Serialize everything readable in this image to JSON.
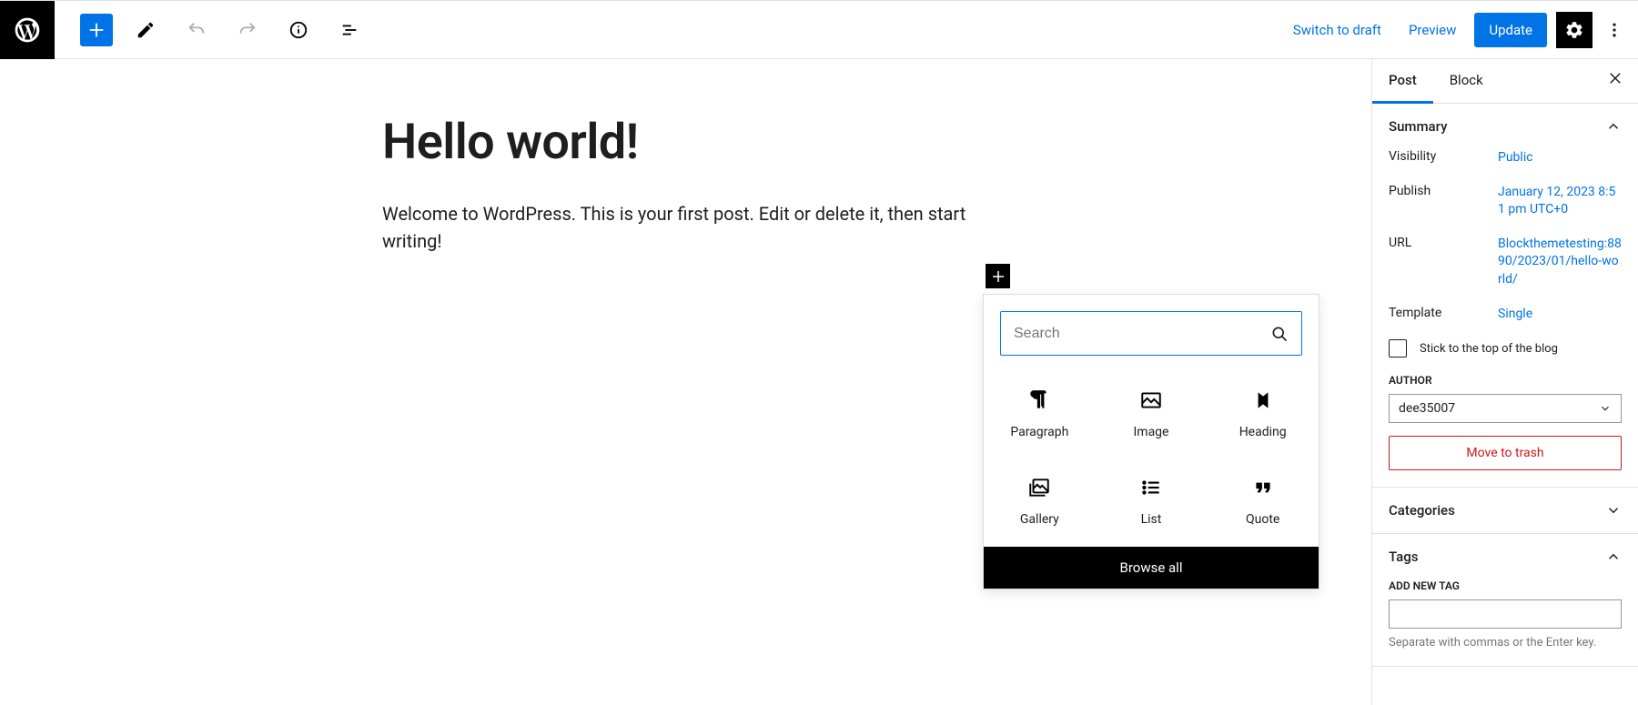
{
  "toolbar": {
    "switch_draft": "Switch to draft",
    "preview": "Preview",
    "update": "Update"
  },
  "post": {
    "title": "Hello world!",
    "body": "Welcome to WordPress. This is your first post. Edit or delete it, then start writing!"
  },
  "inserter": {
    "search_placeholder": "Search",
    "blocks": [
      {
        "label": "Paragraph"
      },
      {
        "label": "Image"
      },
      {
        "label": "Heading"
      },
      {
        "label": "Gallery"
      },
      {
        "label": "List"
      },
      {
        "label": "Quote"
      }
    ],
    "browse_all": "Browse all"
  },
  "sidebar": {
    "tabs": {
      "post": "Post",
      "block": "Block"
    },
    "summary": {
      "title": "Summary",
      "visibility_label": "Visibility",
      "visibility_value": "Public",
      "publish_label": "Publish",
      "publish_value": "January 12, 2023 8:51 pm UTC+0",
      "url_label": "URL",
      "url_value": "Blockthemetesting:8890/2023/01/hello-world/",
      "template_label": "Template",
      "template_value": "Single",
      "sticky_label": "Stick to the top of the blog",
      "author_label": "AUTHOR",
      "author_value": "dee35007",
      "trash": "Move to trash"
    },
    "categories": {
      "title": "Categories"
    },
    "tags": {
      "title": "Tags",
      "add_label": "ADD NEW TAG",
      "hint": "Separate with commas or the Enter key."
    }
  }
}
